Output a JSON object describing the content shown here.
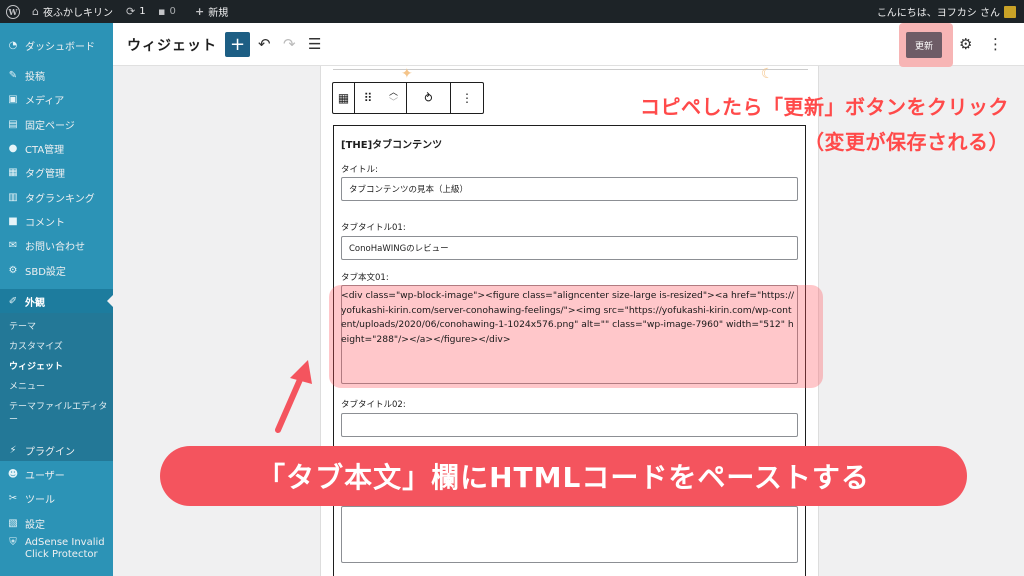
{
  "adminbar": {
    "site_name": "夜ふかしキリン",
    "updates_count": "1",
    "comments_count": "0",
    "new_label": "新規",
    "greeting": "こんにちは、ヨフカシ さん"
  },
  "sidebar": {
    "items": [
      {
        "label": "ダッシュボード",
        "icon": "dashboard-icon"
      },
      {
        "label": "投稿",
        "icon": "pin-icon"
      },
      {
        "label": "メディア",
        "icon": "media-icon"
      },
      {
        "label": "固定ページ",
        "icon": "page-icon"
      },
      {
        "label": "CTA管理",
        "icon": "bulb-icon"
      },
      {
        "label": "タグ管理",
        "icon": "table-icon"
      },
      {
        "label": "タグランキング",
        "icon": "ranking-icon"
      },
      {
        "label": "コメント",
        "icon": "comment-icon"
      },
      {
        "label": "お問い合わせ",
        "icon": "mail-icon"
      },
      {
        "label": "SBD設定",
        "icon": "gear-icon"
      },
      {
        "label": "外観",
        "icon": "brush-icon"
      }
    ],
    "submenu": [
      "テーマ",
      "カスタマイズ",
      "ウィジェット",
      "メニュー",
      "テーマファイルエディター"
    ],
    "lower_items": [
      {
        "label": "プラグイン",
        "icon": "plug-icon"
      },
      {
        "label": "ユーザー",
        "icon": "user-icon"
      },
      {
        "label": "ツール",
        "icon": "wrench-icon"
      },
      {
        "label": "設定",
        "icon": "settings-icon"
      },
      {
        "label": "AdSense Invalid Click Protector",
        "icon": "shield-icon"
      }
    ]
  },
  "header": {
    "title": "ウィジェット",
    "update_label": "更新"
  },
  "widget": {
    "title": "[THE]タブコンテンツ",
    "fields": [
      {
        "label": "タイトル:",
        "value": "タブコンテンツの見本（上級）"
      },
      {
        "label": "タブタイトル01:",
        "value": "ConoHaWINGのレビュー"
      },
      {
        "label": "タブ本文01:",
        "value": "<div class=\"wp-block-image\"><figure class=\"aligncenter size-large is-resized\"><a href=\"https://yofukashi-kirin.com/server-conohawing-feelings/\"><img src=\"https://yofukashi-kirin.com/wp-content/uploads/2020/06/conohawing-1-1024x576.png\" alt=\"\" class=\"wp-image-7960\" width=\"512\" height=\"288\"/></a></figure></div>"
      },
      {
        "label": "タブタイトル02:",
        "value": ""
      }
    ]
  },
  "annotations": {
    "top_line1": "コピペしたら「更新」ボタンをクリック",
    "top_line2": "（変更が保存される）",
    "banner": "「タブ本文」欄にHTMLコードをペーストする"
  },
  "colors": {
    "sidebar": "#2c93b6",
    "accent_red": "#f4545e",
    "update_button": "#6d5c66",
    "add_button": "#1d5e84"
  }
}
